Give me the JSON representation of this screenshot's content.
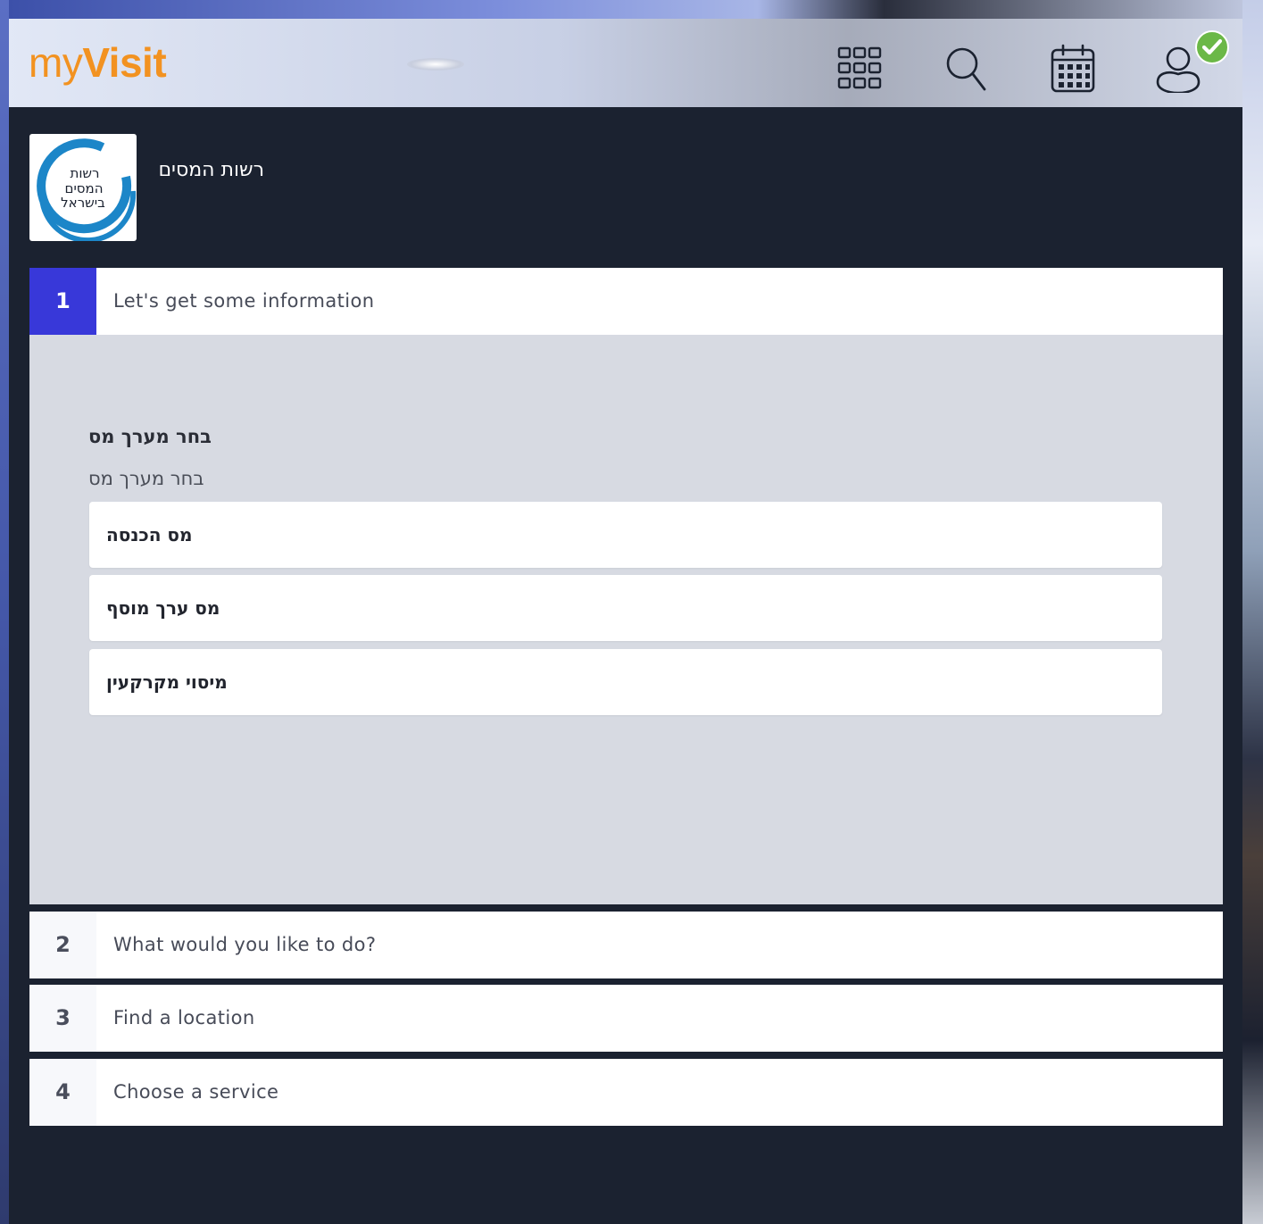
{
  "header": {
    "logo": {
      "part1": "my",
      "part2": "Visit"
    },
    "icons": [
      "apps-grid-icon",
      "search-icon",
      "calendar-icon",
      "user-icon"
    ],
    "badge_icon": "check-badge-icon"
  },
  "organization": {
    "name": "רשות המסים",
    "logo_text": [
      "רשות",
      "המסים",
      "בישראל"
    ]
  },
  "steps": [
    {
      "number": "1",
      "label": "Let's get some information",
      "active": true
    },
    {
      "number": "2",
      "label": "What would you like to do?",
      "active": false
    },
    {
      "number": "3",
      "label": "Find a location",
      "active": false
    },
    {
      "number": "4",
      "label": "Choose a service",
      "active": false
    }
  ],
  "question": {
    "title": "בחר מערך מס",
    "subtitle": "בחר מערך מס",
    "options": [
      "מס הכנסה",
      "מס ערך מוסף",
      "מיסוי מקרקעין"
    ]
  },
  "colors": {
    "accent": "#3838d9",
    "brand_orange": "#f29221",
    "app_background": "#1b2230",
    "panel": "#d7dae2",
    "check_green": "#6bb847",
    "org_blue": "#1c86c8"
  }
}
